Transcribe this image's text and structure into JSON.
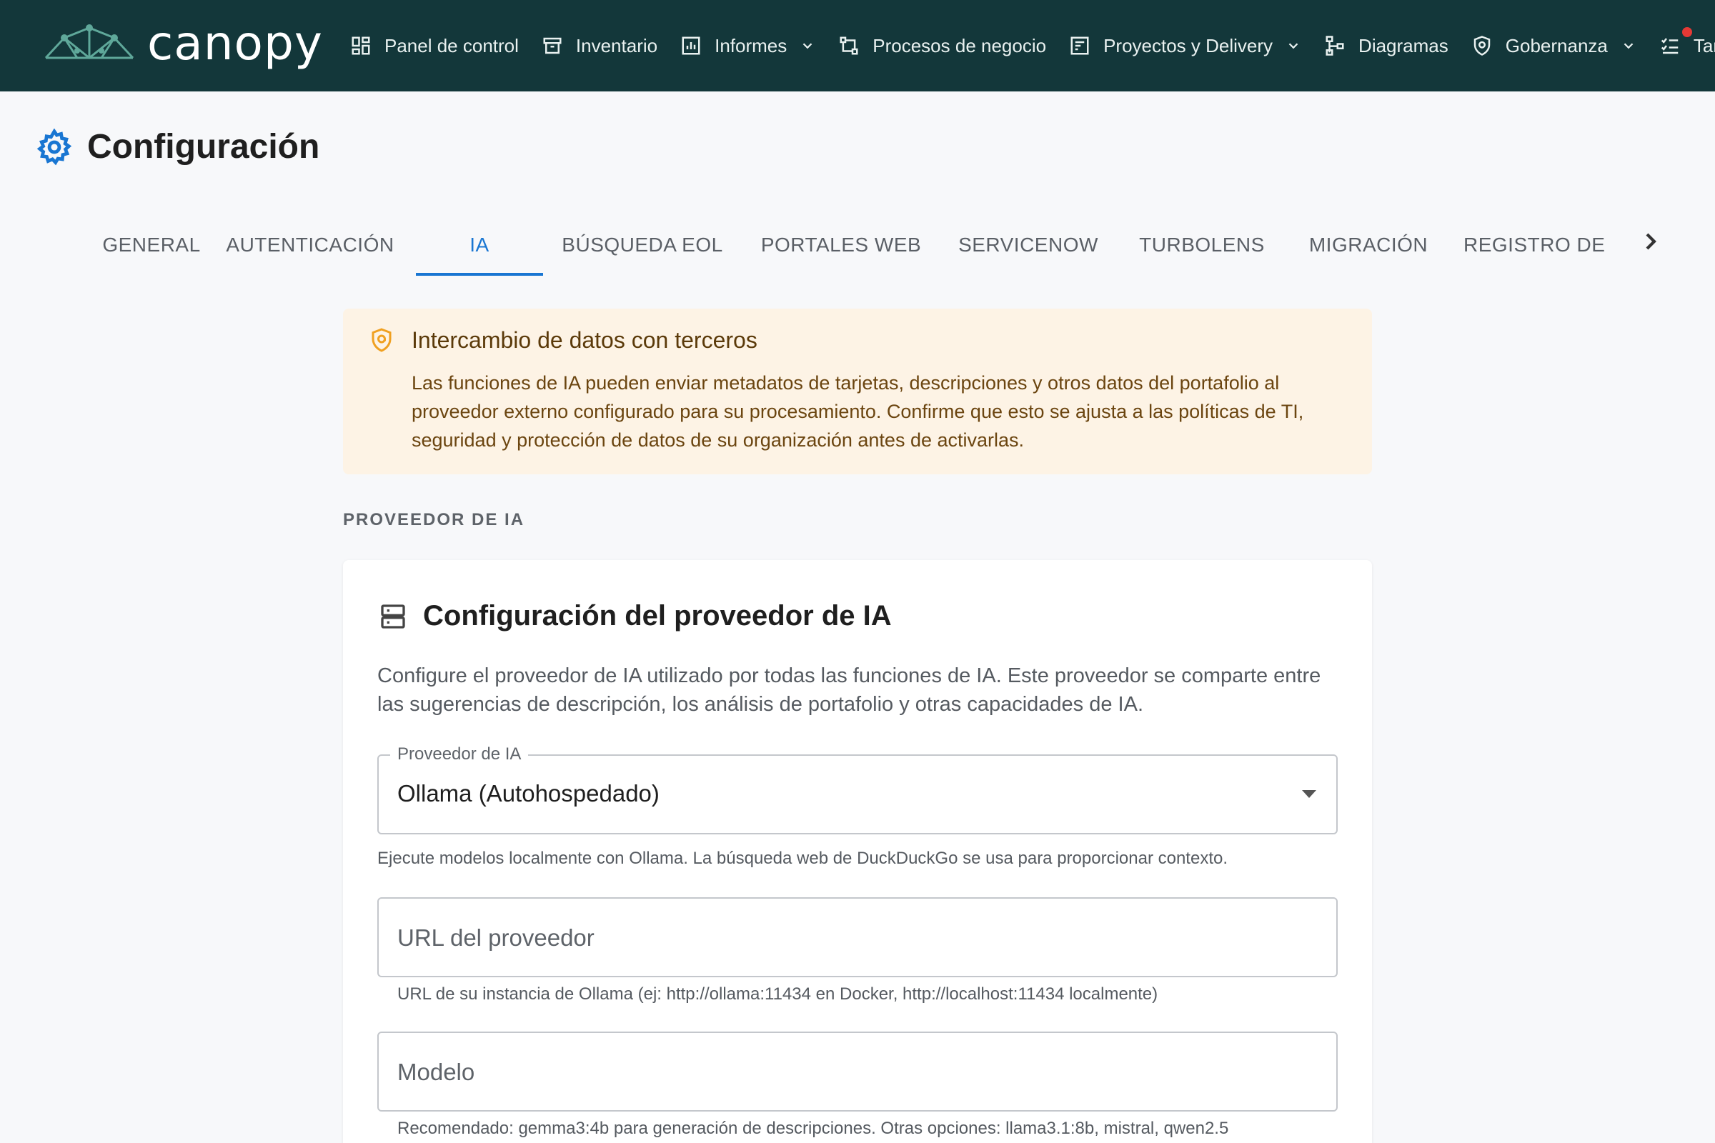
{
  "app": {
    "brand": "canopy",
    "colors": {
      "topbar": "#13373a",
      "accent": "#1976d2",
      "banner_bg": "#fdf3e5",
      "notification": "#e53935"
    }
  },
  "nav": {
    "items": [
      {
        "label": "Panel de control",
        "icon": "dashboard-icon",
        "dropdown": false
      },
      {
        "label": "Inventario",
        "icon": "archive-box-icon",
        "dropdown": false
      },
      {
        "label": "Informes",
        "icon": "bar-chart-icon",
        "dropdown": true
      },
      {
        "label": "Procesos de negocio",
        "icon": "process-flow-icon",
        "dropdown": false
      },
      {
        "label": "Proyectos y Delivery",
        "icon": "project-board-icon",
        "dropdown": true
      },
      {
        "label": "Diagramas",
        "icon": "hierarchy-icon",
        "dropdown": false
      },
      {
        "label": "Gobernanza",
        "icon": "shield-icon",
        "dropdown": true
      },
      {
        "label": "Tare",
        "icon": "checklist-icon",
        "dropdown": false,
        "notification": true
      }
    ]
  },
  "page": {
    "title": "Configuración",
    "icon": "gear-icon"
  },
  "tabs": {
    "items": [
      "GENERAL",
      "AUTENTICACIÓN",
      "IA",
      "BÚSQUEDA EOL",
      "PORTALES WEB",
      "SERVICENOW",
      "TURBOLENS",
      "MIGRACIÓN",
      "REGISTRO DE"
    ],
    "active": "IA"
  },
  "banner": {
    "title": "Intercambio de datos con terceros",
    "text": "Las funciones de IA pueden enviar metadatos de tarjetas, descripciones y otros datos del portafolio al proveedor externo configurado para su procesamiento. Confirme que esto se ajusta a las políticas de TI, seguridad y protección de datos de su organización antes de activarlas."
  },
  "section": {
    "label": "PROVEEDOR DE IA"
  },
  "card": {
    "title": "Configuración del proveedor de IA",
    "description": "Configure el proveedor de IA utilizado por todas las funciones de IA. Este proveedor se comparte entre las sugerencias de descripción, los análisis de portafolio y otras capacidades de IA.",
    "provider": {
      "label": "Proveedor de IA",
      "value": "Ollama (Autohospedado)",
      "helper": "Ejecute modelos localmente con Ollama. La búsqueda web de DuckDuckGo se usa para proporcionar contexto."
    },
    "url": {
      "placeholder": "URL del proveedor",
      "value": "",
      "helper": "URL de su instancia de Ollama (ej: http://ollama:11434 en Docker, http://localhost:11434 localmente)"
    },
    "model": {
      "placeholder": "Modelo",
      "value": "",
      "helper": "Recomendado: gemma3:4b para generación de descripciones. Otras opciones: llama3.1:8b, mistral, qwen2.5"
    }
  }
}
